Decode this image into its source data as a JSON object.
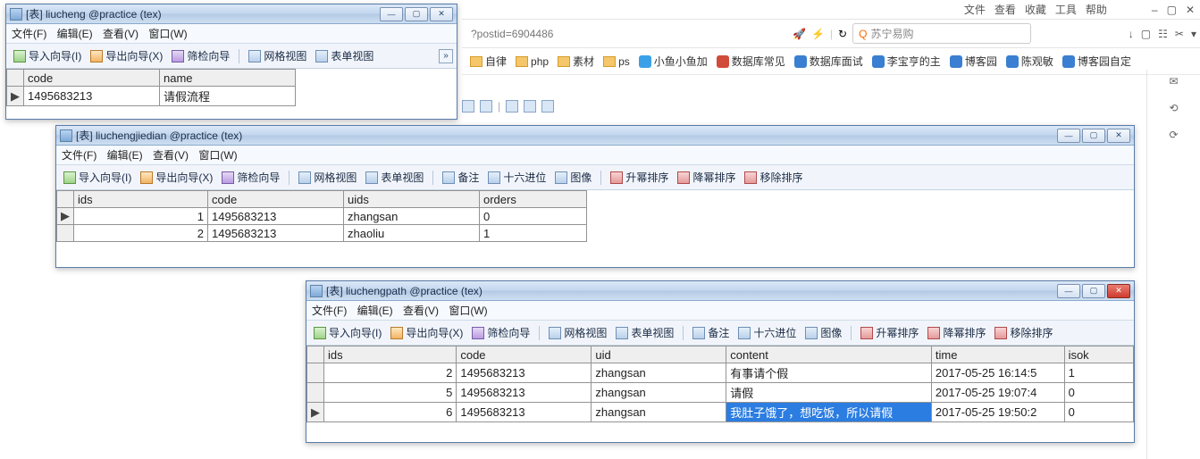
{
  "browser": {
    "top_menu": [
      "文件",
      "查看",
      "收藏",
      "工具",
      "帮助"
    ],
    "sys_buttons": [
      "–",
      "▢",
      "✕"
    ],
    "address": "?postid=6904486",
    "search_placeholder": "苏宁易购",
    "toolbar_icons": [
      "⚡",
      "↻",
      "✓"
    ],
    "right_icons": [
      "↓",
      "▢",
      "☷",
      "✂",
      "▾"
    ],
    "bookmarks": [
      {
        "label": "自律",
        "type": "folder"
      },
      {
        "label": "php",
        "type": "folder"
      },
      {
        "label": "素材",
        "type": "folder"
      },
      {
        "label": "ps",
        "type": "folder"
      },
      {
        "label": "小鱼小鱼加",
        "type": "site",
        "color": "#3aa0e8"
      },
      {
        "label": "数据库常见",
        "type": "site",
        "color": "#d14b3a"
      },
      {
        "label": "数据库面试",
        "type": "site",
        "color": "#3a7fd1"
      },
      {
        "label": "李宝亨的主",
        "type": "site",
        "color": "#3a7fd1"
      },
      {
        "label": "博客园",
        "type": "site",
        "color": "#3a7fd1"
      },
      {
        "label": "陈观敏",
        "type": "site",
        "color": "#3a7fd1"
      },
      {
        "label": "博客园自定",
        "type": "site",
        "color": "#3a7fd1"
      }
    ],
    "side": [
      "✉",
      "⟲",
      "⟳"
    ]
  },
  "menus": {
    "file": "文件(F)",
    "edit": "编辑(E)",
    "view": "查看(V)",
    "window": "窗口(W)"
  },
  "toolbar": {
    "import": "导入向导(I)",
    "export": "导出向导(X)",
    "filter": "筛检向导",
    "gridview": "网格视图",
    "formview": "表单视图",
    "memo": "备注",
    "hex": "十六进位",
    "image": "图像",
    "sort_asc": "升幂排序",
    "sort_desc": "降幂排序",
    "sort_clear": "移除排序"
  },
  "win1": {
    "title": "[表] liucheng @practice (tex)",
    "columns": [
      "code",
      "name"
    ],
    "widths": [
      152,
      152
    ],
    "rows": [
      {
        "marker": "▶",
        "cells": [
          "1495683213",
          "请假流程"
        ]
      }
    ]
  },
  "win2": {
    "title": "[表] liuchengjiedian @practice (tex)",
    "columns": [
      "ids",
      "code",
      "uids",
      "orders"
    ],
    "widths": [
      150,
      152,
      152,
      120
    ],
    "rows": [
      {
        "marker": "▶",
        "cells": [
          "1",
          "1495683213",
          "zhangsan",
          "0"
        ]
      },
      {
        "marker": "",
        "cells": [
          "2",
          "1495683213",
          "zhaoliu",
          "1"
        ]
      }
    ]
  },
  "win3": {
    "title": "[表] liuchengpath @practice (tex)",
    "columns": [
      "ids",
      "code",
      "uid",
      "content",
      "time",
      "isok"
    ],
    "widths": [
      150,
      152,
      152,
      232,
      150,
      78
    ],
    "rows": [
      {
        "marker": "",
        "cells": [
          "2",
          "1495683213",
          "zhangsan",
          "有事请个假",
          "2017-05-25 16:14:5",
          "1"
        ]
      },
      {
        "marker": "",
        "cells": [
          "5",
          "1495683213",
          "zhangsan",
          "请假",
          "2017-05-25 19:07:4",
          "0"
        ]
      },
      {
        "marker": "▶",
        "selected": true,
        "cells": [
          "6",
          "1495683213",
          "zhangsan",
          "我肚子饿了，想吃饭，所以请假",
          "2017-05-25 19:50:2",
          "0"
        ]
      }
    ]
  }
}
